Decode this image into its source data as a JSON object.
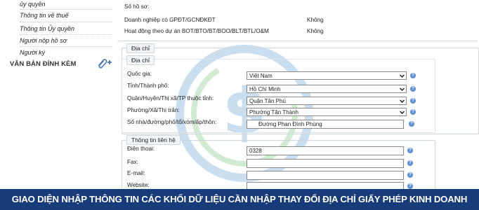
{
  "sidebar": {
    "items": [
      {
        "label": "ủy quyền"
      },
      {
        "label": "Thông tin về thuế"
      },
      {
        "label": "Thông tin Ủy quyền"
      },
      {
        "label": "Người nộp hồ sơ"
      },
      {
        "label": "Người ký"
      }
    ],
    "section_title": "VĂN BẢN ĐÍNH KÈM",
    "attach_icon": "paperclip-plus-icon"
  },
  "top": {
    "so_ho_so_label": "Số hồ sơ:",
    "rows": [
      {
        "label": "Doanh nghiệp có GPĐT/GCNĐKĐT",
        "value": "Không"
      },
      {
        "label": "Hoạt động theo dự án BOT/BTO/BT/BOO/BLT/BTL/O&M",
        "value": "Không"
      }
    ]
  },
  "address": {
    "outer_tab": "Địa chỉ",
    "inner_tab": "Địa chỉ",
    "fields": [
      {
        "label": "Quốc gia:",
        "value": "Việt Nam"
      },
      {
        "label": "Tỉnh/Thành phố:",
        "value": "Hồ Chí Minh"
      },
      {
        "label": "Quận/Huyện/Thị xã/TP thuộc tỉnh:",
        "value": "Quận Tân Phú"
      },
      {
        "label": "Phường/Xã/Thị trấn:",
        "value": "Phường Tân Thành"
      }
    ],
    "street_label": "Số nhà/đường/phố/tổ/xóm/ấp/thôn:",
    "street_value": "Đường Phan Đình Phùng"
  },
  "contact": {
    "tab": "Thông tin liên hệ",
    "fields": [
      {
        "label": "Điện thoại:",
        "value": "0328"
      },
      {
        "label": "Fax:",
        "value": ""
      },
      {
        "label": "E-mail:",
        "value": ""
      },
      {
        "label": "Website:",
        "value": ""
      }
    ]
  },
  "help_glyph": "?",
  "banner": "GIAO DIỆN NHẬP THÔNG TIN CÁC KHỐI DỮ LIỆU CẦN NHẬP THAY ĐỔI ĐỊA CHỈ GIẤY PHÉP KINH DOANH",
  "colors": {
    "banner_bg": "#183b7a",
    "help_icon": "#5b8fd6",
    "watermark": "#3a8fc9"
  }
}
